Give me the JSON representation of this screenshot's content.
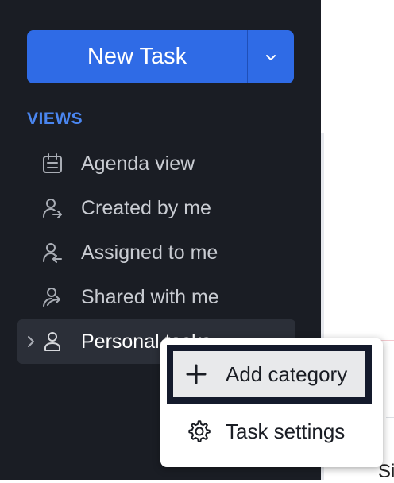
{
  "sidebar": {
    "new_task_label": "New Task",
    "new_task_dropdown_icon": "chevron-down-icon",
    "views_heading": "VIEWS",
    "items": [
      {
        "label": "Agenda view",
        "icon": "calendar-list-icon"
      },
      {
        "label": "Created by me",
        "icon": "user-arrow-right-icon"
      },
      {
        "label": "Assigned to me",
        "icon": "user-arrow-left-icon"
      },
      {
        "label": "Shared with me",
        "icon": "user-share-icon"
      },
      {
        "label": "Personal tasks",
        "icon": "user-icon"
      }
    ]
  },
  "context_menu": {
    "items": [
      {
        "label": "Add category",
        "icon": "plus-icon"
      },
      {
        "label": "Task settings",
        "icon": "gear-icon"
      }
    ]
  },
  "main": {
    "partial_text": "Si"
  },
  "colors": {
    "sidebar_bg": "#1a1d24",
    "accent": "#2f6be6",
    "views_label": "#4a86f0"
  }
}
